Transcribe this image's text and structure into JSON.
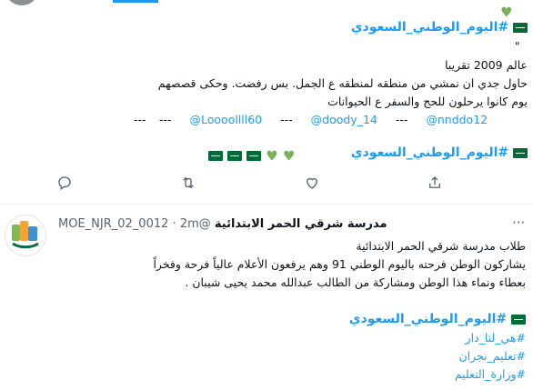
{
  "tweet1": {
    "hashtag_top": "#اليوم_الوطني_السعودي",
    "quote_mark": "\"",
    "line_year": "عالم 2009 تقريبا",
    "line_story_1": "حاول جدي ان نمشي من منطقه لمنطقه ع الجمل. بس رفضت. وحكى قصصهم",
    "line_story_2": "يوم كانوا يرحلون للحج والسفر ع الحيوانات",
    "dashes": "---",
    "mentions": [
      "@nnddo12",
      "@doody_14",
      "@Loooollll60"
    ],
    "hashtag_bottom": "#اليوم_الوطني_السعودي",
    "actions": [
      "reply-icon",
      "retweet-icon",
      "like-icon",
      "share-icon"
    ]
  },
  "tweet2": {
    "display_name": "مدرسة شرقي الحمر الابتدائية",
    "handle": "@MOE_NJR_02_0012",
    "separator": "·",
    "time": "2m",
    "text_line_1": "طلاب مدرسة شرقي الحمر الابتدائية",
    "text_line_2": "يشاركون الوطن فرحته باليوم الوطني 91 وهم يرفعون الأعلام عالياً فرحة وفخراً",
    "text_line_3": "بعطاء ونماء هذا الوطن ومشاركة من الطالب عبدالله محمد يحيى شيبان .",
    "hashtags": [
      "#اليوم_الوطني_السعودي",
      "#هي_لنا_دار",
      "#تعليم_نجران",
      "#وزارة_التعليم"
    ]
  },
  "colors": {
    "accent": "#1d9bf0",
    "text": "#0f1419",
    "muted": "#536471",
    "divider": "#eff3f4",
    "green": "#006c35"
  }
}
